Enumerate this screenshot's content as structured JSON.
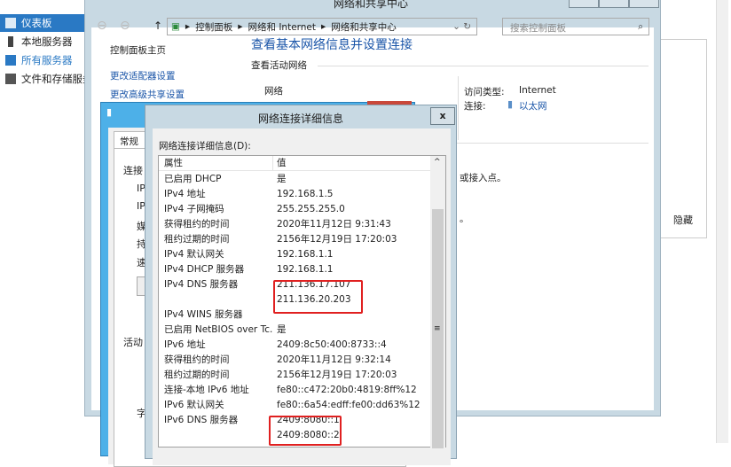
{
  "sidebar": {
    "items": [
      {
        "label": "仪表板",
        "selected": true
      },
      {
        "label": "本地服务器"
      },
      {
        "label": "所有服务器"
      },
      {
        "label": "文件和存储服务"
      }
    ]
  },
  "nsc": {
    "title": "网络和共享中心",
    "breadcrumb": [
      "控制面板",
      "网络和 Internet",
      "网络和共享中心"
    ],
    "search_placeholder": "搜索控制面板",
    "nav": [
      "控制面板主页",
      "更改适配器设置",
      "更改高级共享设置"
    ],
    "heading": "查看基本网络信息并设置连接",
    "active_networks": "查看活动网络",
    "network_label": "网络",
    "access_type_label": "访问类型:",
    "access_type_value": "Internet",
    "connection_label": "连接:",
    "connection_value": "以太网",
    "partial_text1": "或接入点。",
    "partial_text2": "。"
  },
  "right_panel": {
    "hide_label": "隐藏"
  },
  "eth": {
    "tab": "常规",
    "labels": [
      "连接",
      "IP",
      "IP",
      "媒",
      "持",
      "速",
      "活动",
      "字"
    ]
  },
  "details": {
    "title": "网络连接详细信息",
    "list_label": "网络连接详细信息(D):",
    "headers": [
      "属性",
      "值"
    ],
    "rows": [
      [
        "已启用 DHCP",
        "是"
      ],
      [
        "IPv4 地址",
        "192.168.1.5"
      ],
      [
        "IPv4 子网掩码",
        "255.255.255.0"
      ],
      [
        "获得租约的时间",
        "2020年11月12日 9:31:43"
      ],
      [
        "租约过期的时间",
        "2156年12月19日 17:20:03"
      ],
      [
        "IPv4 默认网关",
        "192.168.1.1"
      ],
      [
        "IPv4 DHCP 服务器",
        "192.168.1.1"
      ],
      [
        "IPv4 DNS 服务器",
        "211.136.17.107"
      ],
      [
        "",
        "211.136.20.203"
      ],
      [
        "IPv4 WINS 服务器",
        ""
      ],
      [
        "已启用 NetBIOS over Tc...",
        "是"
      ],
      [
        "IPv6 地址",
        "2409:8c50:400:8733::4"
      ],
      [
        "获得租约的时间",
        "2020年11月12日 9:32:14"
      ],
      [
        "租约过期的时间",
        "2156年12月19日 17:20:03"
      ],
      [
        "连接-本地 IPv6 地址",
        "fe80::c472:20b0:4819:8ff%12"
      ],
      [
        "IPv6 默认网关",
        "fe80::6a54:edff:fe00:dd63%12"
      ],
      [
        "IPv6 DNS 服务器",
        "2409:8080::1"
      ],
      [
        "",
        "2409:8080::2"
      ]
    ],
    "close": "x"
  },
  "colors": {
    "accent": "#2a79c4",
    "highlight": "#e02020"
  }
}
